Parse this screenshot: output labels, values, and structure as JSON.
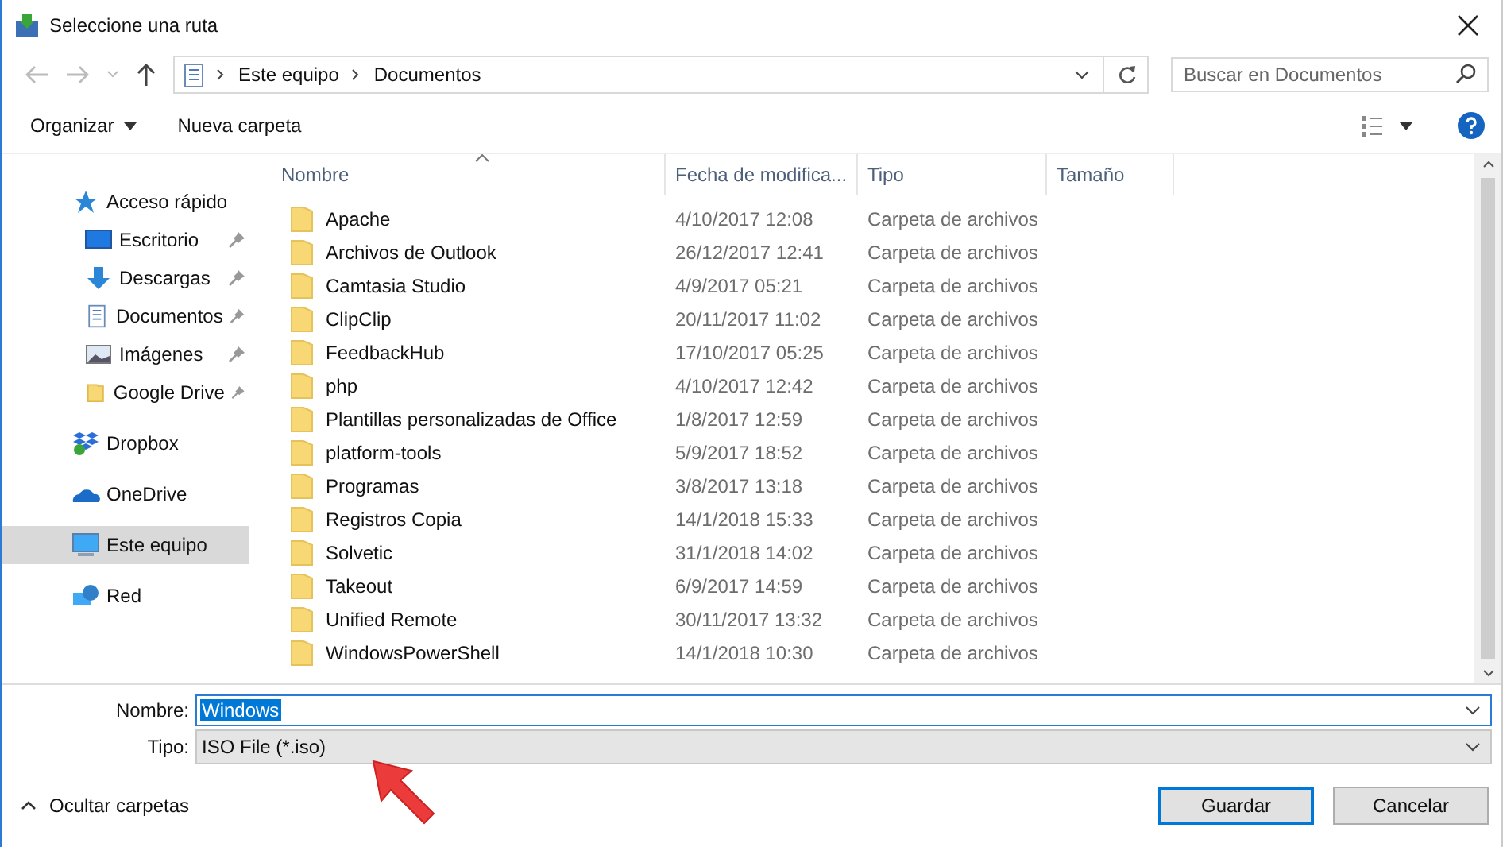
{
  "window": {
    "title": "Seleccione una ruta"
  },
  "address_bar": {
    "crumbs": [
      "Este equipo",
      "Documentos"
    ],
    "search_placeholder": "Buscar en Documentos"
  },
  "toolbar": {
    "organize": "Organizar",
    "new_folder": "Nueva carpeta"
  },
  "sidebar": {
    "items": [
      {
        "label": "Acceso rápido",
        "selected": false,
        "children": [
          {
            "label": "Escritorio",
            "pinned": true,
            "selected": false
          },
          {
            "label": "Descargas",
            "pinned": true,
            "selected": false
          },
          {
            "label": "Documentos",
            "pinned": true,
            "selected": false
          },
          {
            "label": "Imágenes",
            "pinned": true,
            "selected": false
          },
          {
            "label": "Google Drive",
            "pinned": true,
            "selected": false
          }
        ]
      },
      {
        "label": "Dropbox",
        "selected": false
      },
      {
        "label": "OneDrive",
        "selected": false
      },
      {
        "label": "Este equipo",
        "selected": true
      },
      {
        "label": "Red",
        "selected": false
      }
    ]
  },
  "table": {
    "columns": [
      "Nombre",
      "Fecha de modifica...",
      "Tipo",
      "Tamaño"
    ],
    "rows": [
      {
        "name": "Apache",
        "date": "4/10/2017 12:08",
        "type": "Carpeta de archivos"
      },
      {
        "name": "Archivos de Outlook",
        "date": "26/12/2017 12:41",
        "type": "Carpeta de archivos"
      },
      {
        "name": "Camtasia Studio",
        "date": "4/9/2017 05:21",
        "type": "Carpeta de archivos"
      },
      {
        "name": "ClipClip",
        "date": "20/11/2017 11:02",
        "type": "Carpeta de archivos"
      },
      {
        "name": "FeedbackHub",
        "date": "17/10/2017 05:25",
        "type": "Carpeta de archivos"
      },
      {
        "name": "php",
        "date": "4/10/2017 12:42",
        "type": "Carpeta de archivos"
      },
      {
        "name": "Plantillas personalizadas de Office",
        "date": "1/8/2017 12:59",
        "type": "Carpeta de archivos"
      },
      {
        "name": "platform-tools",
        "date": "5/9/2017 18:52",
        "type": "Carpeta de archivos"
      },
      {
        "name": "Programas",
        "date": "3/8/2017 13:18",
        "type": "Carpeta de archivos"
      },
      {
        "name": "Registros Copia",
        "date": "14/1/2018 15:33",
        "type": "Carpeta de archivos"
      },
      {
        "name": "Solvetic",
        "date": "31/1/2018 14:02",
        "type": "Carpeta de archivos"
      },
      {
        "name": "Takeout",
        "date": "6/9/2017 14:59",
        "type": "Carpeta de archivos"
      },
      {
        "name": "Unified Remote",
        "date": "30/11/2017 13:32",
        "type": "Carpeta de archivos"
      },
      {
        "name": "WindowsPowerShell",
        "date": "14/1/2018 10:30",
        "type": "Carpeta de archivos"
      }
    ]
  },
  "form": {
    "name_label": "Nombre:",
    "name_value": "Windows",
    "type_label": "Tipo:",
    "type_value": "ISO File (*.iso)"
  },
  "footer": {
    "hide_folders": "Ocultar carpetas",
    "buttons": [
      {
        "label": "Guardar",
        "default": true
      },
      {
        "label": "Cancelar",
        "default": false
      }
    ]
  }
}
